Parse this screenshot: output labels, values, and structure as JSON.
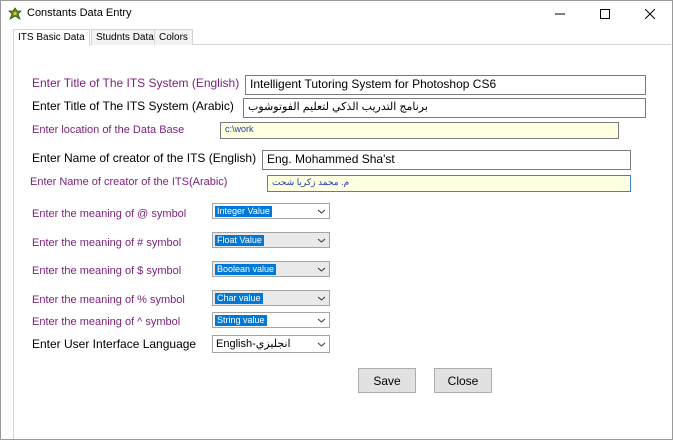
{
  "window": {
    "title": "Constants Data Entry",
    "minimize_glyph": "minimize-icon",
    "maximize_glyph": "maximize-icon",
    "close_glyph": "close-icon"
  },
  "tabs": [
    {
      "label": "ITS Basic Data",
      "active": true
    },
    {
      "label": "Studnts Data",
      "active": false
    },
    {
      "label": "Colors",
      "active": false
    }
  ],
  "form": {
    "title_en": {
      "label": "Enter Title of The ITS System (English)",
      "value": "Intelligent Tutoring System for Photoshop CS6"
    },
    "title_ar": {
      "label": "Enter Title of The ITS System (Arabic)",
      "value": "برنامج التدريب الذكي لتعليم الفوتوشوب"
    },
    "db_location": {
      "label": "Enter location of the Data Base",
      "value": "c:\\work"
    },
    "creator_en": {
      "label": "Enter Name of creator of the ITS (English)",
      "value": "Eng. Mohammed Sha'st"
    },
    "creator_ar": {
      "label": "Enter Name of creator of the ITS(Arabic)",
      "value": "م. محمد زكريا شحت"
    },
    "sym_at": {
      "label": "Enter the meaning of @ symbol",
      "value": "Integer Value"
    },
    "sym_hash": {
      "label": "Enter the meaning of # symbol",
      "value": "Float Value"
    },
    "sym_dollar": {
      "label": "Enter the meaning of $ symbol",
      "value": "Boolean value"
    },
    "sym_percent": {
      "label": "Enter the meaning of % symbol",
      "value": "Char value"
    },
    "sym_caret": {
      "label": "Enter the meaning of ^ symbol",
      "value": "String value"
    },
    "ui_language": {
      "label": "Enter User Interface Language",
      "value": "English-انجليزي"
    }
  },
  "buttons": {
    "save": "Save",
    "close": "Close"
  },
  "colors": {
    "label_purple": "#7a1f7a",
    "selection_blue": "#0078d7",
    "field_yellow": "#ffffe1"
  }
}
